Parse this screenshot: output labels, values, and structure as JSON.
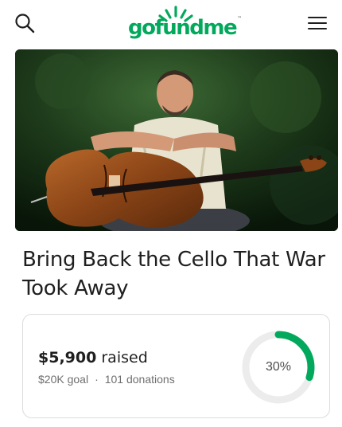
{
  "header": {
    "logo_text": "gofundme",
    "logo_mark": "™",
    "search_icon": "search-icon",
    "menu_icon": "hamburger-menu-icon",
    "brand_color": "#02a95c"
  },
  "campaign": {
    "title": "Bring Back the Cello That War Took Away",
    "raised_amount": "$5,900",
    "raised_word": "raised",
    "goal": "$20K goal",
    "separator": "·",
    "donations": "101 donations",
    "progress_label": "30%",
    "progress_fraction": 0.3,
    "progress_color": "#02a95c",
    "track_color": "#ececec"
  }
}
